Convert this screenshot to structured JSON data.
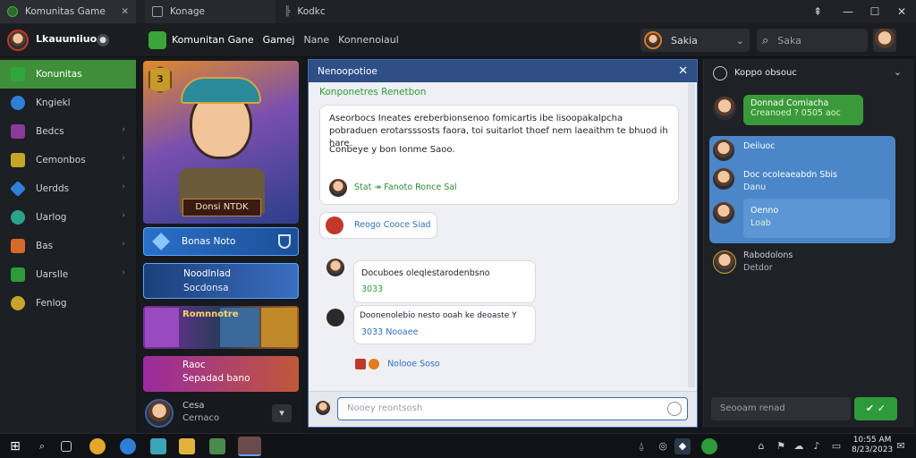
{
  "browser": {
    "tabs": [
      {
        "label": "Komunitas Game"
      },
      {
        "label": "Konage"
      },
      {
        "label": "Kodkc"
      }
    ],
    "window_controls": {
      "minimize": "—",
      "maximize": "☐",
      "close": "✕",
      "pin": "⇞"
    }
  },
  "app": {
    "brand": "Lkauuniiuoc",
    "title_words": [
      "Komunitan Gane",
      "Gamej",
      "Nane",
      "Konnenoiaul"
    ],
    "user_label": "Sakia",
    "search": {
      "placeholder": "Saka"
    }
  },
  "sidebar": {
    "items": [
      {
        "label": "Konunitas",
        "active": true,
        "color": "#2e9b3a"
      },
      {
        "label": "Kngiekl",
        "active": false,
        "color": "#2f7fd6"
      },
      {
        "label": "Bedcs",
        "active": false,
        "color": "#8a3a9a"
      },
      {
        "label": "Cemonbos",
        "active": false,
        "color": "#c9a42a"
      },
      {
        "label": "Uerdds",
        "active": false,
        "color": "#2f7fd6"
      },
      {
        "label": "Uarlog",
        "active": false,
        "color": "#2aa38a"
      },
      {
        "label": "Bas",
        "active": false,
        "color": "#d66a2a"
      },
      {
        "label": "Uarslle",
        "active": false,
        "color": "#2e9b3a"
      },
      {
        "label": "Fenlog",
        "active": false,
        "color": "#c9a42a"
      }
    ]
  },
  "cards": {
    "hero_badge": "Donsi NTDK",
    "hero_level": "3",
    "card2": "Bonas Noto",
    "card3_line1": "Noodlnlad",
    "card3_line2": "Socdonsa",
    "card4_title": "Romnnotre",
    "card5_line1": "Raoc",
    "card5_line2": "Sepadad bano",
    "profile_line1": "Cesa",
    "profile_line2": "Cernaco"
  },
  "chat": {
    "header": "Nenoopotioe",
    "subtitle": "Konponetres Renetbon",
    "msg1": "Aseorbocs Ineates ereberbionsenoo fomicartis ibe lisoopakalpcha pobraduen erotarsssosts faora, toi suitarlot thoef nem laeaithm te bhuod ih hare.",
    "msg1_sub": "Conbeye y bon Ionme Saoo.",
    "msg1_footer": "Stat ↠ Fanoto  Ronce  Sal",
    "msg2": "Reogo Cooce Siad",
    "msg3": "Docuboes oleqlestarodenbsno",
    "msg3_meta": "3033",
    "msg4": "Doonenolebio nesto ooah ke deoaste Y",
    "msg4_meta": "3033  Nooaee",
    "reactions": "Nolooe  Soso",
    "input_placeholder": "Nooey reontsosh"
  },
  "right": {
    "title": "Koppo obsouc",
    "msgs": [
      {
        "text": "Donnad Comiacha",
        "sub": "Creanoed ? 0505 aoc",
        "kind": "green"
      },
      {
        "text": "Deiiuoc",
        "kind": "blue"
      },
      {
        "text": "Doc ocoleaeabdn Sbis",
        "sub": "Danu",
        "kind": "blue"
      },
      {
        "text": "Oenno",
        "sub": "Loab",
        "kind": "blue"
      },
      {
        "text": "Rabodolons",
        "sub": "Detdor",
        "kind": "dark"
      }
    ],
    "input_placeholder": "Seooam renad"
  },
  "taskbar": {
    "clock_time": "10:55 AM",
    "clock_date": "8/23/2023"
  }
}
